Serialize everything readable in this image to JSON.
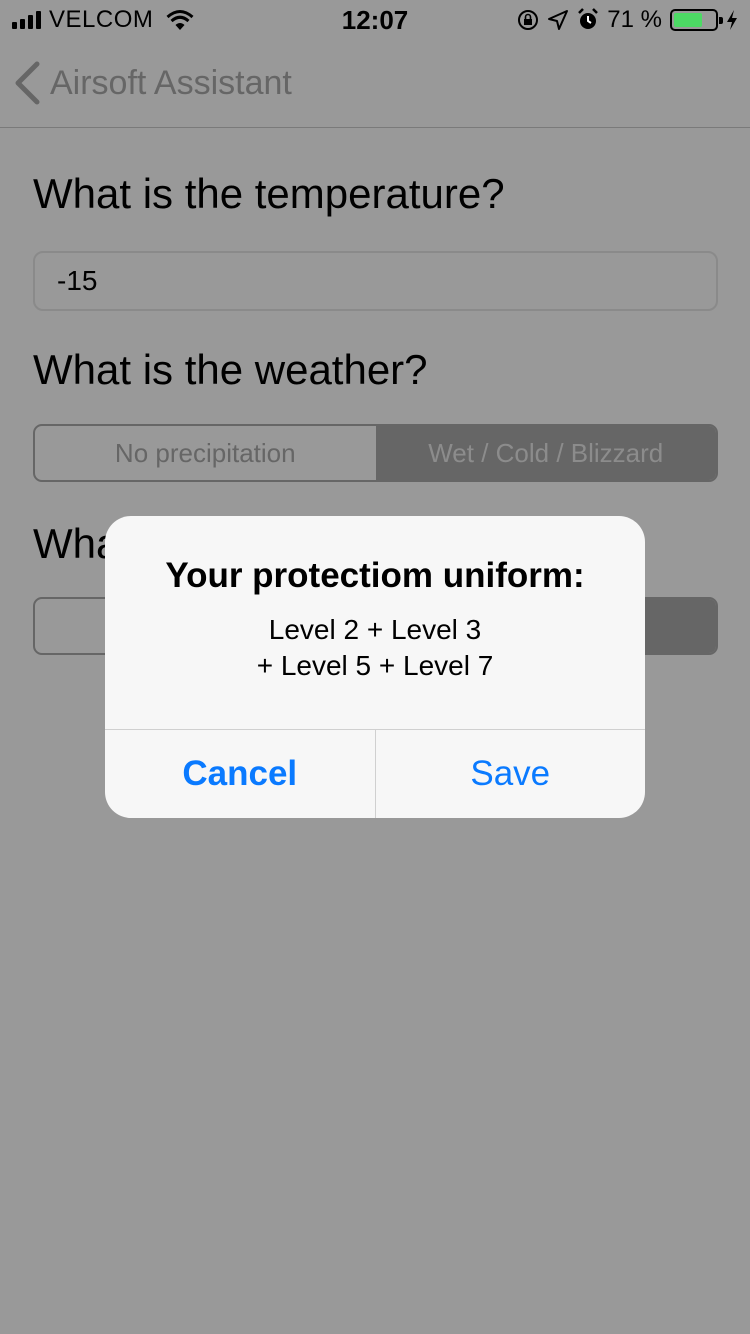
{
  "status_bar": {
    "carrier": "VELCOM",
    "time": "12:07",
    "battery_percent": "71 %",
    "battery_level": 0.71,
    "battery_color": "#4cd964",
    "icons": [
      "signal-icon",
      "wifi-icon",
      "rotation-lock-icon",
      "location-icon",
      "alarm-icon",
      "battery-icon",
      "charging-icon"
    ]
  },
  "nav": {
    "back_label": "Airsoft Assistant"
  },
  "form": {
    "temperature_question": "What is the temperature?",
    "temperature_value": "-15",
    "weather_question": "What is the weather?",
    "weather_options": [
      "No precipitation",
      "Wet / Cold / Blizzard"
    ],
    "weather_selected": "Wet / Cold / Blizzard",
    "third_question_visible": "Wha"
  },
  "alert": {
    "title": "Your protectiom uniform:",
    "message_line1": "Level 2 + Level 3",
    "message_line2": "+ Level 5 + Level 7",
    "cancel_label": "Cancel",
    "save_label": "Save",
    "button_color": "#0a7aff"
  }
}
